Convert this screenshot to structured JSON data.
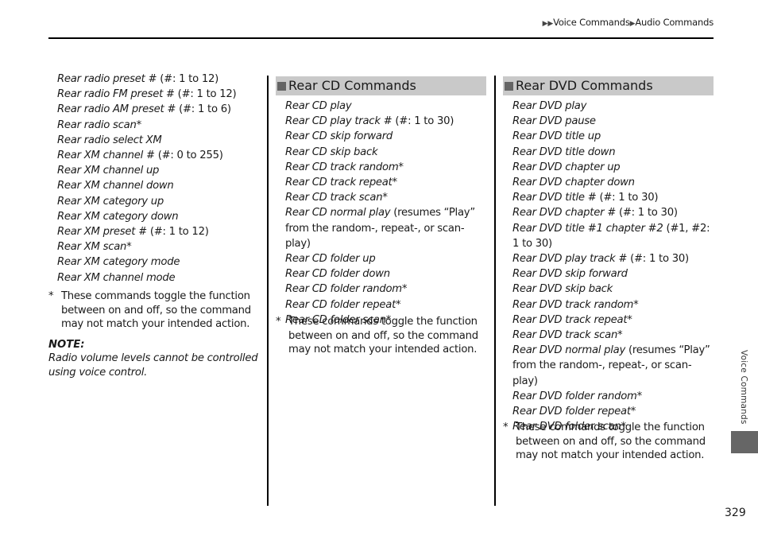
{
  "header": {
    "breadcrumb": [
      {
        "label": "Voice Commands"
      },
      {
        "label": "Audio Commands"
      }
    ],
    "arrow_glyph": "▶"
  },
  "column1": {
    "items": [
      {
        "cmd": "Rear radio preset #",
        "note": " (#: 1 to 12)"
      },
      {
        "cmd": "Rear radio FM preset #",
        "note": " (#: 1 to 12)"
      },
      {
        "cmd": "Rear radio AM preset #",
        "note": " (#: 1 to 6)"
      },
      {
        "cmd": "Rear radio scan*",
        "note": ""
      },
      {
        "cmd": "Rear radio select XM",
        "note": ""
      },
      {
        "cmd": "Rear XM channel #",
        "note": " (#: 0 to 255)"
      },
      {
        "cmd": "Rear XM channel up",
        "note": ""
      },
      {
        "cmd": "Rear XM channel down",
        "note": ""
      },
      {
        "cmd": "Rear XM category up",
        "note": ""
      },
      {
        "cmd": "Rear XM category down",
        "note": ""
      },
      {
        "cmd": "Rear XM preset #",
        "note": " (#: 1 to 12)"
      },
      {
        "cmd": "Rear XM scan*",
        "note": ""
      },
      {
        "cmd": "Rear XM category mode",
        "note": ""
      },
      {
        "cmd": "Rear XM channel mode",
        "note": ""
      }
    ],
    "footnote_star": "*",
    "footnote": "These commands toggle the function between on and off, so the command may not match your intended action.",
    "note_label": "NOTE:",
    "note_text": "Radio volume levels cannot be controlled using voice control."
  },
  "column2": {
    "title": "Rear CD Commands",
    "items": [
      {
        "cmd": "Rear CD play",
        "note": ""
      },
      {
        "cmd": "Rear CD play track #",
        "note": " (#: 1 to 30)"
      },
      {
        "cmd": "Rear CD skip forward",
        "note": ""
      },
      {
        "cmd": "Rear CD skip back",
        "note": ""
      },
      {
        "cmd": "Rear CD track random*",
        "note": ""
      },
      {
        "cmd": "Rear CD track repeat*",
        "note": ""
      },
      {
        "cmd": "Rear CD track scan*",
        "note": ""
      },
      {
        "cmd": "Rear CD normal play",
        "note": " (resumes “Play” from the random-, repeat-, or scan-play)"
      },
      {
        "cmd": "Rear CD folder up",
        "note": ""
      },
      {
        "cmd": "Rear CD folder down",
        "note": ""
      },
      {
        "cmd": "Rear CD folder random*",
        "note": ""
      },
      {
        "cmd": "Rear CD folder repeat*",
        "note": ""
      },
      {
        "cmd": "Rear CD folder scan*",
        "note": ""
      }
    ],
    "footnote_star": "*",
    "footnote": "These commands toggle the function between on and off, so the command may not match your intended action."
  },
  "column3": {
    "title": "Rear DVD Commands",
    "items": [
      {
        "cmd": "Rear DVD play",
        "note": ""
      },
      {
        "cmd": "Rear DVD pause",
        "note": ""
      },
      {
        "cmd": "Rear DVD title up",
        "note": ""
      },
      {
        "cmd": "Rear DVD title down",
        "note": ""
      },
      {
        "cmd": "Rear DVD chapter up",
        "note": ""
      },
      {
        "cmd": "Rear DVD chapter down",
        "note": ""
      },
      {
        "cmd": "Rear DVD title #",
        "note": " (#: 1 to 30)"
      },
      {
        "cmd": "Rear DVD chapter #",
        "note": " (#: 1 to 30)"
      },
      {
        "cmd": "Rear DVD title #1 chapter #2",
        "note": " (#1, #2: 1 to 30)"
      },
      {
        "cmd": "Rear DVD play track #",
        "note": " (#: 1 to 30)"
      },
      {
        "cmd": "Rear DVD skip forward",
        "note": ""
      },
      {
        "cmd": "Rear DVD skip back",
        "note": ""
      },
      {
        "cmd": "Rear DVD track random*",
        "note": ""
      },
      {
        "cmd": "Rear DVD track repeat*",
        "note": ""
      },
      {
        "cmd": "Rear DVD track scan*",
        "note": ""
      },
      {
        "cmd": "Rear DVD normal play",
        "note": " (resumes “Play” from the random-, repeat-, or scan-play)"
      },
      {
        "cmd": "Rear DVD folder random*",
        "note": ""
      },
      {
        "cmd": "Rear DVD folder repeat*",
        "note": ""
      },
      {
        "cmd": "Rear DVD folder scan*",
        "note": ""
      }
    ],
    "footnote_star": "*",
    "footnote": "These commands toggle the function between on and off, so the command may not match your intended action."
  },
  "side_tab": {
    "label": "Voice Commands"
  },
  "page_number": "329",
  "colors": {
    "section_band": "#c9c9c9",
    "section_marker": "#646464",
    "side_tab_block": "#666666",
    "rule": "#000000"
  }
}
